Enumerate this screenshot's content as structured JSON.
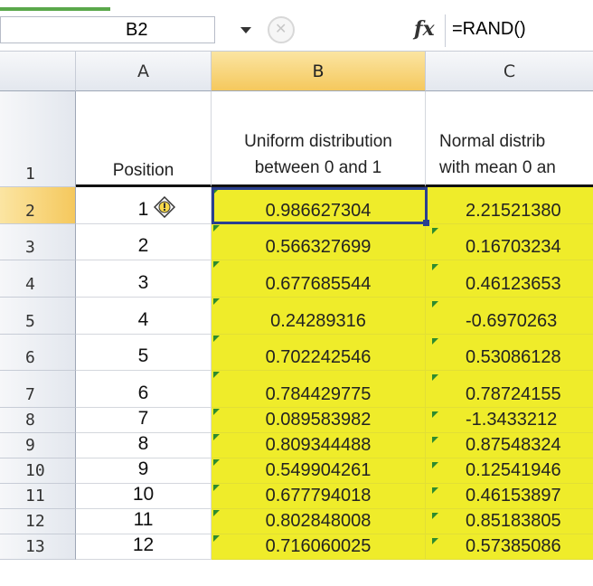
{
  "formula_bar": {
    "name_box": "B2",
    "fx_symbol": "fx",
    "formula": "=RAND()"
  },
  "columns": {
    "corner": "",
    "a": "A",
    "b": "B",
    "c": "C"
  },
  "header_row": {
    "row_label": "1",
    "a": "Position",
    "b_line1": "Uniform distribution",
    "b_line2": "between 0 and 1",
    "c_line1": "Normal distrib",
    "c_line2": "with mean 0 an"
  },
  "rows": [
    {
      "row": "2",
      "a": "1",
      "b": "0.986627304",
      "c": "2.21521380"
    },
    {
      "row": "3",
      "a": "2",
      "b": "0.566327699",
      "c": "0.16703234"
    },
    {
      "row": "4",
      "a": "3",
      "b": "0.677685544",
      "c": "0.46123653"
    },
    {
      "row": "5",
      "a": "4",
      "b": "0.24289316",
      "c": "-0.6970263"
    },
    {
      "row": "6",
      "a": "5",
      "b": "0.702242546",
      "c": "0.53086128"
    },
    {
      "row": "7",
      "a": "6",
      "b": "0.784429775",
      "c": "0.78724155"
    },
    {
      "row": "8",
      "a": "7",
      "b": "0.089583982",
      "c": "-1.3433212"
    },
    {
      "row": "9",
      "a": "8",
      "b": "0.809344488",
      "c": "0.87548324"
    },
    {
      "row": "10",
      "a": "9",
      "b": "0.549904261",
      "c": "0.12541946"
    },
    {
      "row": "11",
      "a": "10",
      "b": "0.677794018",
      "c": "0.46153897"
    },
    {
      "row": "12",
      "a": "11",
      "b": "0.802848008",
      "c": "0.85183805"
    },
    {
      "row": "13",
      "a": "12",
      "b": "0.716060025",
      "c": "0.57385086"
    }
  ],
  "colors": {
    "highlight": "#efec2a",
    "selected_header": "#f5c85d",
    "active_border": "#2a3f8f"
  },
  "icons": {
    "error_indicator": "warning-diamond-icon",
    "cancel": "cancel-circle-icon",
    "dropdown": "chevron-down-icon"
  }
}
